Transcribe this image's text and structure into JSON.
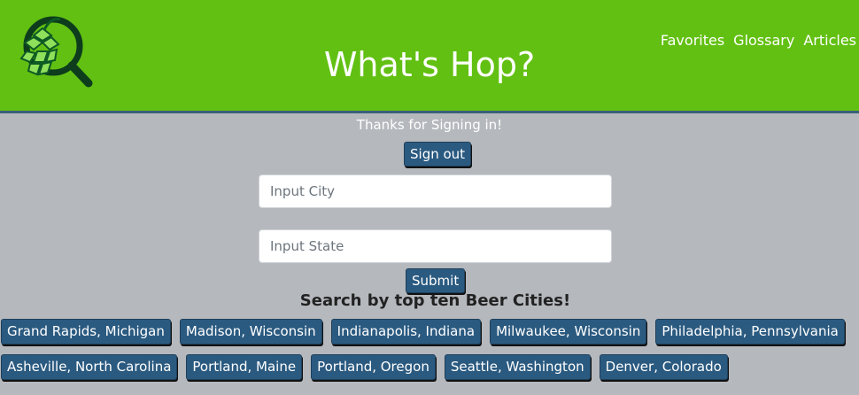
{
  "header": {
    "title": "What's Hop?",
    "background_color": "#62c012",
    "logo_icon": "hop-magnifier-icon"
  },
  "nav": {
    "items": [
      {
        "label": "Favorites"
      },
      {
        "label": "Glossary"
      },
      {
        "label": "Articles"
      }
    ]
  },
  "auth": {
    "message": "Thanks for Signing in!",
    "sign_out_label": "Sign out"
  },
  "search": {
    "city_placeholder": "Input City",
    "state_placeholder": "Input State",
    "submit_label": "Submit"
  },
  "top_cities": {
    "title": "Search by top ten Beer Cities!",
    "row1": [
      {
        "label": "Grand Rapids, Michigan"
      },
      {
        "label": "Madison, Wisconsin"
      },
      {
        "label": "Indianapolis, Indiana"
      },
      {
        "label": "Milwaukee, Wisconsin"
      },
      {
        "label": "Philadelphia, Pennsylvania"
      }
    ],
    "row2": [
      {
        "label": "Asheville, North Carolina"
      },
      {
        "label": "Portland, Maine"
      },
      {
        "label": "Portland, Oregon"
      },
      {
        "label": "Seattle, Washington"
      },
      {
        "label": "Denver, Colorado"
      }
    ]
  },
  "colors": {
    "page_bg": "#b5b8bd",
    "button_bg": "#2b5a80"
  }
}
